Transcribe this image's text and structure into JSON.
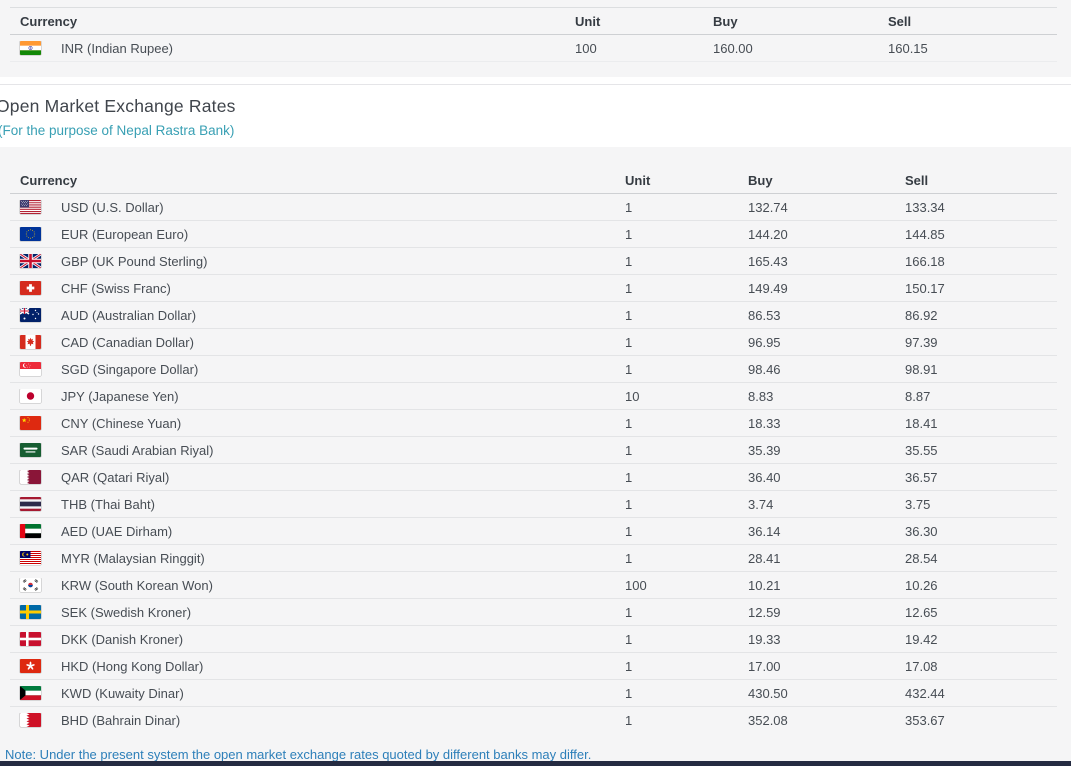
{
  "page": {
    "title": "Open Market Exchange Rates",
    "subtitle": "(For the purpose of Nepal Rastra Bank)",
    "note": "Note: Under the present system the open market exchange rates quoted by different banks may differ.",
    "colors": {
      "page_background": "#f5f5f6",
      "title_band_background": "#ffffff",
      "subtitle_teal": "#39a0b4",
      "note_blue": "#2d7fb9",
      "footer_navy": "#242b41",
      "row_separator": "#e3e4e6",
      "header_text": "#363c43",
      "row_text": "#474d54"
    }
  },
  "inr_table": {
    "headers": [
      "Currency",
      "Unit",
      "Buy",
      "Sell"
    ],
    "rows": [
      {
        "code": "inr",
        "flag": "india-flag-icon",
        "currency": "INR (Indian Rupee)",
        "unit": "100",
        "buy": "160.00",
        "sell": "160.15"
      }
    ]
  },
  "open_market_table": {
    "headers": [
      "Currency",
      "Unit",
      "Buy",
      "Sell"
    ],
    "rows": [
      {
        "code": "usd",
        "flag": "usa-flag-icon",
        "currency": "USD (U.S. Dollar)",
        "unit": "1",
        "buy": "132.74",
        "sell": "133.34"
      },
      {
        "code": "eur",
        "flag": "eu-flag-icon",
        "currency": "EUR (European Euro)",
        "unit": "1",
        "buy": "144.20",
        "sell": "144.85"
      },
      {
        "code": "gbp",
        "flag": "uk-flag-icon",
        "currency": "GBP (UK Pound Sterling)",
        "unit": "1",
        "buy": "165.43",
        "sell": "166.18"
      },
      {
        "code": "chf",
        "flag": "switzerland-flag-icon",
        "currency": "CHF (Swiss Franc)",
        "unit": "1",
        "buy": "149.49",
        "sell": "150.17"
      },
      {
        "code": "aud",
        "flag": "australia-flag-icon",
        "currency": "AUD (Australian Dollar)",
        "unit": "1",
        "buy": "86.53",
        "sell": "86.92"
      },
      {
        "code": "cad",
        "flag": "canada-flag-icon",
        "currency": "CAD (Canadian Dollar)",
        "unit": "1",
        "buy": "96.95",
        "sell": "97.39"
      },
      {
        "code": "sgd",
        "flag": "singapore-flag-icon",
        "currency": "SGD (Singapore Dollar)",
        "unit": "1",
        "buy": "98.46",
        "sell": "98.91"
      },
      {
        "code": "jpy",
        "flag": "japan-flag-icon",
        "currency": "JPY (Japanese Yen)",
        "unit": "10",
        "buy": "8.83",
        "sell": "8.87"
      },
      {
        "code": "cny",
        "flag": "china-flag-icon",
        "currency": "CNY (Chinese Yuan)",
        "unit": "1",
        "buy": "18.33",
        "sell": "18.41"
      },
      {
        "code": "sar",
        "flag": "saudi-arabia-flag-icon",
        "currency": "SAR (Saudi Arabian Riyal)",
        "unit": "1",
        "buy": "35.39",
        "sell": "35.55"
      },
      {
        "code": "qar",
        "flag": "qatar-flag-icon",
        "currency": "QAR (Qatari Riyal)",
        "unit": "1",
        "buy": "36.40",
        "sell": "36.57"
      },
      {
        "code": "thb",
        "flag": "thailand-flag-icon",
        "currency": "THB (Thai Baht)",
        "unit": "1",
        "buy": "3.74",
        "sell": "3.75"
      },
      {
        "code": "aed",
        "flag": "uae-flag-icon",
        "currency": "AED (UAE Dirham)",
        "unit": "1",
        "buy": "36.14",
        "sell": "36.30"
      },
      {
        "code": "myr",
        "flag": "malaysia-flag-icon",
        "currency": "MYR (Malaysian Ringgit)",
        "unit": "1",
        "buy": "28.41",
        "sell": "28.54"
      },
      {
        "code": "krw",
        "flag": "south-korea-flag-icon",
        "currency": "KRW (South Korean Won)",
        "unit": "100",
        "buy": "10.21",
        "sell": "10.26"
      },
      {
        "code": "sek",
        "flag": "sweden-flag-icon",
        "currency": "SEK (Swedish Kroner)",
        "unit": "1",
        "buy": "12.59",
        "sell": "12.65"
      },
      {
        "code": "dkk",
        "flag": "denmark-flag-icon",
        "currency": "DKK (Danish Kroner)",
        "unit": "1",
        "buy": "19.33",
        "sell": "19.42"
      },
      {
        "code": "hkd",
        "flag": "hong-kong-flag-icon",
        "currency": "HKD (Hong Kong Dollar)",
        "unit": "1",
        "buy": "17.00",
        "sell": "17.08"
      },
      {
        "code": "kwd",
        "flag": "kuwait-flag-icon",
        "currency": "KWD (Kuwaity Dinar)",
        "unit": "1",
        "buy": "430.50",
        "sell": "432.44"
      },
      {
        "code": "bhd",
        "flag": "bahrain-flag-icon",
        "currency": "BHD (Bahrain Dinar)",
        "unit": "1",
        "buy": "352.08",
        "sell": "353.67"
      }
    ]
  }
}
